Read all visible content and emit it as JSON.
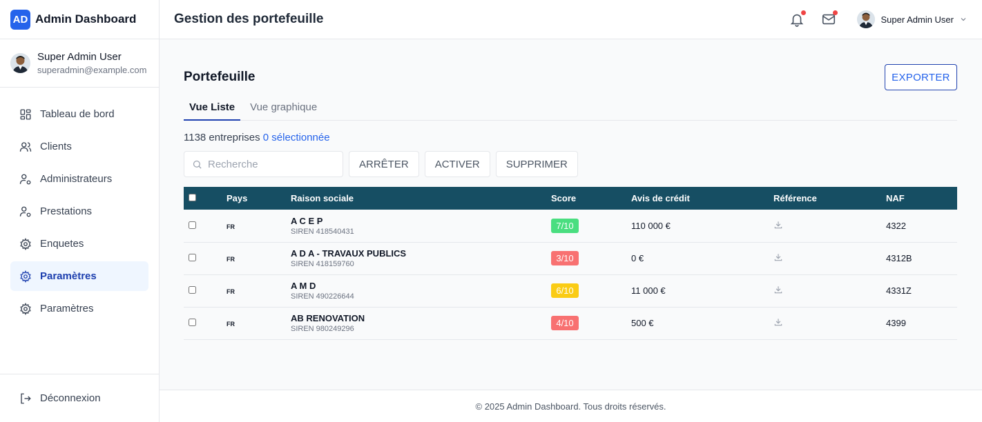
{
  "brand": {
    "logo": "AD",
    "title": "Admin Dashboard"
  },
  "sidebar_user": {
    "name": "Super Admin User",
    "email": "superadmin@example.com"
  },
  "nav": [
    {
      "label": "Tableau de bord",
      "icon": "grid-icon"
    },
    {
      "label": "Clients",
      "icon": "users-icon"
    },
    {
      "label": "Administrateurs",
      "icon": "user-cog-icon"
    },
    {
      "label": "Prestations",
      "icon": "user-cog-icon"
    },
    {
      "label": "Enquetes",
      "icon": "gear-icon"
    },
    {
      "label": "Paramètres",
      "icon": "gear-icon",
      "active": true
    },
    {
      "label": "Paramètres",
      "icon": "gear-icon"
    }
  ],
  "logout_label": "Déconnexion",
  "header": {
    "title": "Gestion des portefeuille",
    "user_name": "Super Admin User"
  },
  "card": {
    "title": "Portefeuille",
    "export_label": "EXPORTER"
  },
  "tabs": [
    "Vue Liste",
    "Vue graphique"
  ],
  "summary": {
    "count_text": "1138 entreprises",
    "selected_text": "0 sélectionnée"
  },
  "search": {
    "placeholder": "Recherche"
  },
  "actions": {
    "stop": "ARRÊTER",
    "activate": "ACTIVER",
    "delete": "SUPPRIMER"
  },
  "table": {
    "headers": {
      "country": "Pays",
      "name": "Raison sociale",
      "score": "Score",
      "credit": "Avis de crédit",
      "reference": "Référence",
      "naf": "NAF"
    },
    "rows": [
      {
        "country": "FR",
        "name": "A C E P",
        "siren": "SIREN 418540431",
        "score": "7/10",
        "score_color": "#4ade80",
        "credit": "110 000 €",
        "naf": "4322"
      },
      {
        "country": "FR",
        "name": "A D A - TRAVAUX PUBLICS",
        "siren": "SIREN 418159760",
        "score": "3/10",
        "score_color": "#f87171",
        "credit": "0 €",
        "naf": "4312B"
      },
      {
        "country": "FR",
        "name": "A M D",
        "siren": "SIREN 490226644",
        "score": "6/10",
        "score_color": "#facc15",
        "credit": "11 000 €",
        "naf": "4331Z"
      },
      {
        "country": "FR",
        "name": "AB RENOVATION",
        "siren": "SIREN 980249296",
        "score": "4/10",
        "score_color": "#f87171",
        "credit": "500 €",
        "naf": "4399"
      }
    ]
  },
  "footer": "© 2025 Admin Dashboard. Tous droits réservés.",
  "colors": {
    "accent": "#2563eb",
    "table_header": "#164e63",
    "active_nav_bg": "#eff6ff"
  }
}
